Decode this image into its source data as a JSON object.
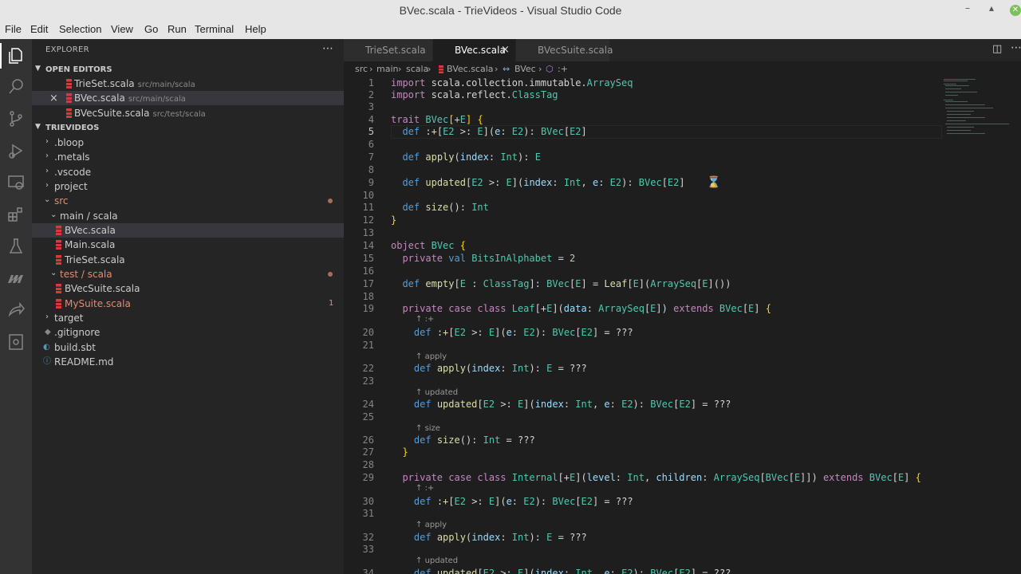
{
  "window": {
    "title": "BVec.scala - TrieVideos - Visual Studio Code"
  },
  "menu": [
    "File",
    "Edit",
    "Selection",
    "View",
    "Go",
    "Run",
    "Terminal",
    "Help"
  ],
  "sidebar": {
    "title": "EXPLORER",
    "open_editors_label": "OPEN EDITORS",
    "open_editors": [
      {
        "name": "TrieSet.scala",
        "path": "src/main/scala"
      },
      {
        "name": "BVec.scala",
        "path": "src/main/scala",
        "close": "×"
      },
      {
        "name": "BVecSuite.scala",
        "path": "src/test/scala"
      }
    ],
    "project_label": "TRIEVIDEOS",
    "tree": [
      {
        "name": ".bloop"
      },
      {
        "name": ".metals"
      },
      {
        "name": ".vscode"
      },
      {
        "name": "project"
      },
      {
        "name": "src"
      },
      {
        "name": "main / scala"
      },
      {
        "name": "BVec.scala"
      },
      {
        "name": "Main.scala"
      },
      {
        "name": "TrieSet.scala"
      },
      {
        "name": "test / scala"
      },
      {
        "name": "BVecSuite.scala"
      },
      {
        "name": "MySuite.scala",
        "badge": "1"
      },
      {
        "name": "target"
      },
      {
        "name": ".gitignore"
      },
      {
        "name": "build.sbt"
      },
      {
        "name": "README.md"
      }
    ]
  },
  "tabs": [
    {
      "label": "TrieSet.scala"
    },
    {
      "label": "BVec.scala",
      "close": "×"
    },
    {
      "label": "BVecSuite.scala"
    }
  ],
  "breadcrumb": [
    "src",
    "main",
    "scala",
    "BVec.scala",
    "BVec",
    ":+"
  ],
  "editor": {
    "line_numbers": [
      "1",
      "2",
      "3",
      "4",
      "5",
      "6",
      "7",
      "8",
      "9",
      "10",
      "11",
      "12",
      "13",
      "14",
      "15",
      "16",
      "17",
      "18",
      "19",
      "20",
      "21",
      "22",
      "23",
      "24",
      "25",
      "26",
      "27",
      "28",
      "29",
      "30",
      "31",
      "32",
      "33",
      "34"
    ],
    "current_line": "5",
    "hints": [
      ":+",
      "apply",
      "updated",
      "size",
      ":+",
      "apply",
      "updated"
    ]
  },
  "colors": {
    "accent": "#007acc",
    "scala_icon": "#d63a3a",
    "modified": "#a86c5a"
  }
}
